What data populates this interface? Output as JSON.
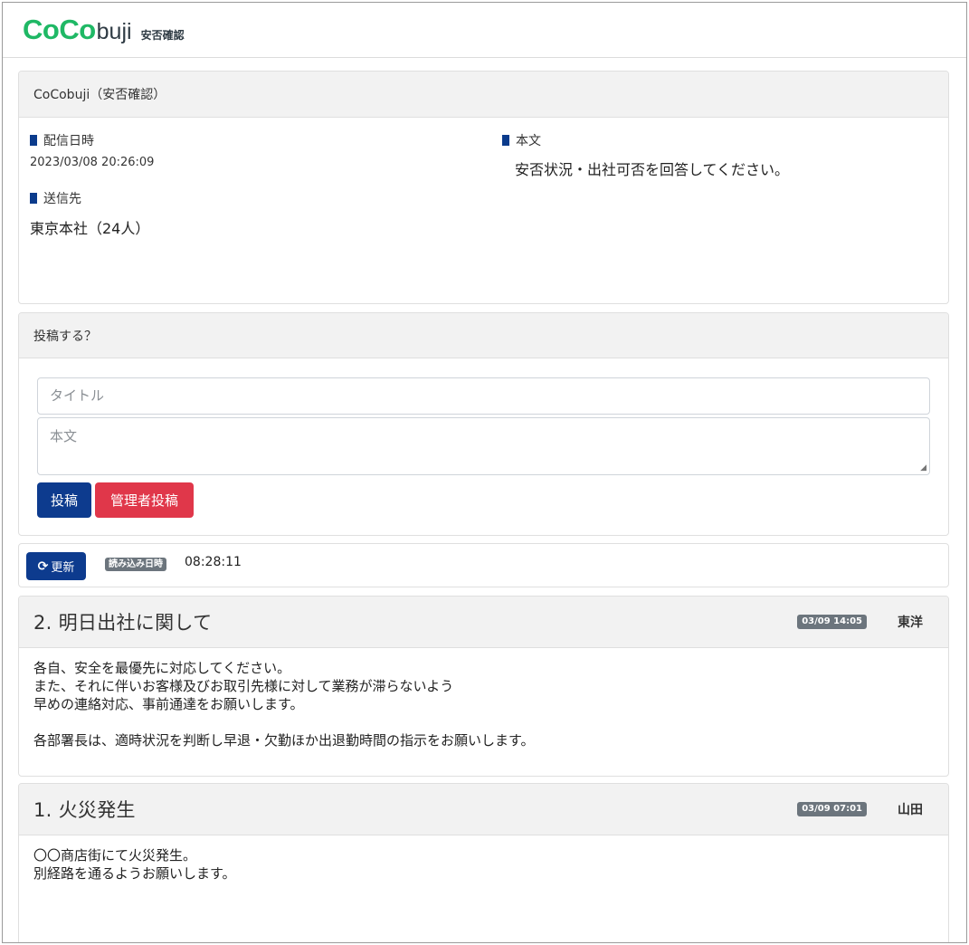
{
  "header": {
    "logo_main": "CoCo",
    "logo_suffix": "buji",
    "logo_sub": "安否確認"
  },
  "info": {
    "card_title": "CoCobuji（安否確認）",
    "date_label": "配信日時",
    "date_value": "2023/03/08 20:26:09",
    "dest_label": "送信先",
    "dest_value": "東京本社（24人）",
    "body_label": "本文",
    "body_value": "安否状況・出社可否を回答してください。"
  },
  "post_form": {
    "card_title": "投稿する？",
    "title_placeholder": "タイトル",
    "body_placeholder": "本文",
    "post_label": "投稿",
    "admin_post_label": "管理者投稿"
  },
  "refresh": {
    "button_label": "更新",
    "loaded_badge": "読み込み日時",
    "loaded_time": "08:28:11"
  },
  "posts": [
    {
      "title": "2.  明日出社に関して",
      "date": "03/09 14:05",
      "author": "東洋",
      "lines": [
        "各自、安全を最優先に対応してください。",
        "また、それに伴いお客様及びお取引先様に対して業務が滞らないよう",
        "早めの連絡対応、事前通達をお願いします。",
        "",
        "各部署長は、適時状況を判断し早退・欠勤ほか出退勤時間の指示をお願いします。"
      ]
    },
    {
      "title": "1.  火災発生",
      "date": "03/09 07:01",
      "author": "山田",
      "lines": [
        "〇〇商店街にて火災発生。",
        "別経路を通るようお願いします。"
      ]
    }
  ],
  "colors": {
    "brand_green": "#1fb865",
    "primary": "#0d3b8e",
    "danger": "#e0374a",
    "badge": "#6c757d"
  }
}
